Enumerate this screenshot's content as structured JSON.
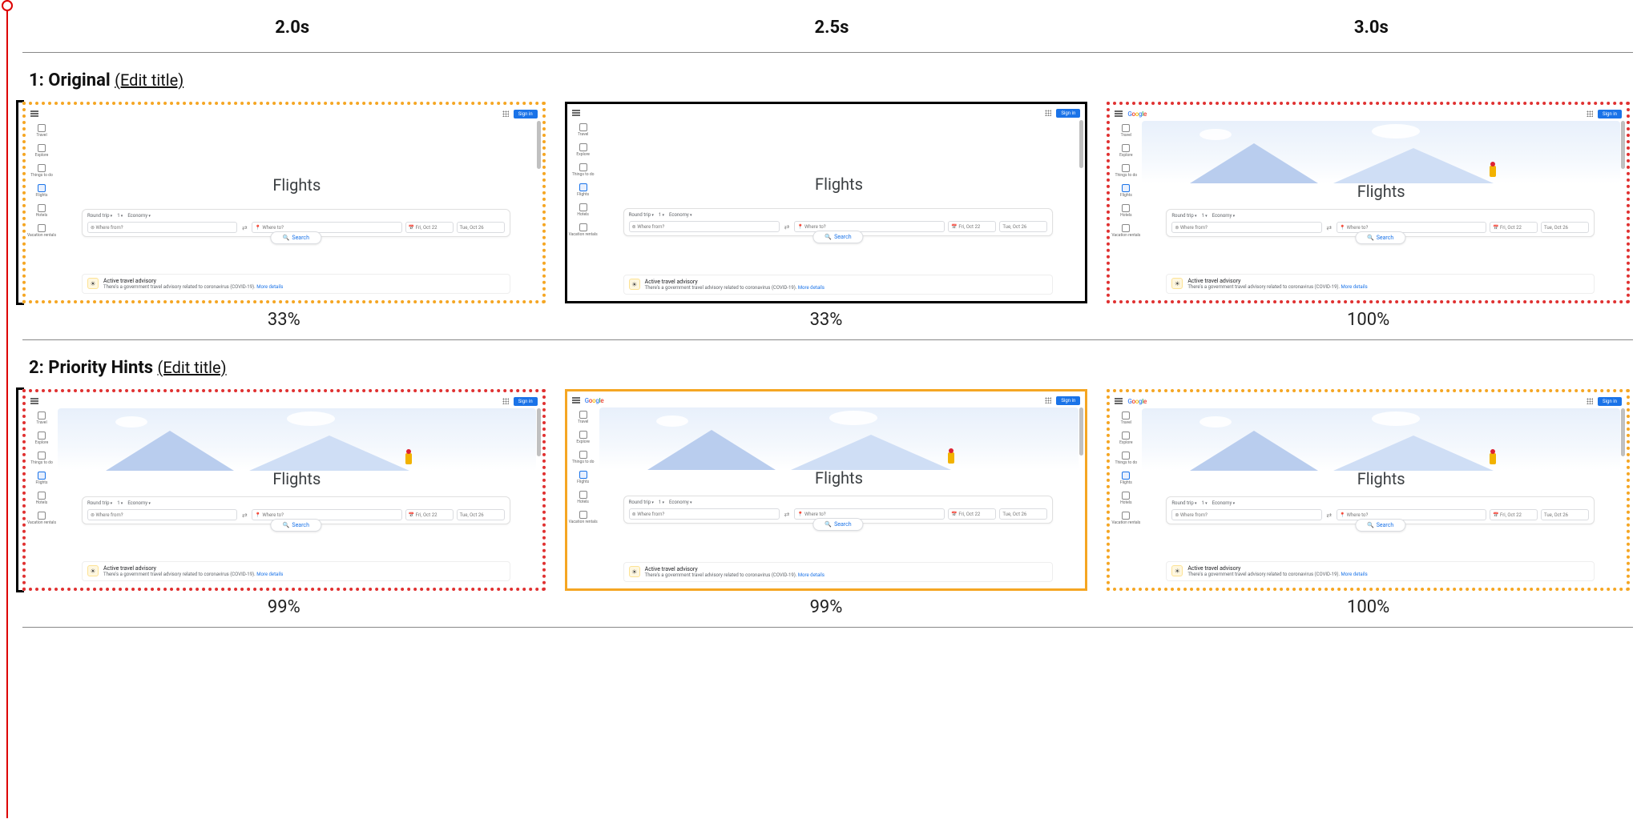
{
  "time_labels": [
    "2.0s",
    "2.5s",
    "3.0s"
  ],
  "sections": [
    {
      "index": "1",
      "title": "Original",
      "edit_label": "(Edit title)",
      "frames": [
        {
          "pct": "33%",
          "border": "dotted-orange",
          "bracket": true,
          "illustration": false,
          "logo": false
        },
        {
          "pct": "33%",
          "border": "solid-black",
          "bracket": false,
          "illustration": false,
          "logo": false
        },
        {
          "pct": "100%",
          "border": "dotted-red",
          "bracket": false,
          "illustration": true,
          "logo": true
        }
      ]
    },
    {
      "index": "2",
      "title": "Priority Hints",
      "edit_label": "(Edit title)",
      "frames": [
        {
          "pct": "99%",
          "border": "dotted-red",
          "bracket": true,
          "illustration": true,
          "logo": false
        },
        {
          "pct": "99%",
          "border": "solid-orange",
          "bracket": false,
          "illustration": true,
          "logo": true
        },
        {
          "pct": "100%",
          "border": "dotted-orange",
          "bracket": false,
          "illustration": true,
          "logo": true
        }
      ]
    }
  ],
  "mockup": {
    "heading": "Flights",
    "signin": "Sign in",
    "sidebar": [
      "Travel",
      "Explore",
      "Things to do",
      "Flights",
      "Hotels",
      "Vacation rentals"
    ],
    "chips": [
      "Round trip",
      "1",
      "Economy"
    ],
    "where_from": "Where from?",
    "where_to": "Where to?",
    "date1": "Fri, Oct 22",
    "date2": "Tue, Oct 26",
    "search": "Search",
    "advisory_title": "Active travel advisory",
    "advisory_sub": "There's a government travel advisory related to coronavirus (COVID-19).",
    "advisory_link": "More details"
  }
}
